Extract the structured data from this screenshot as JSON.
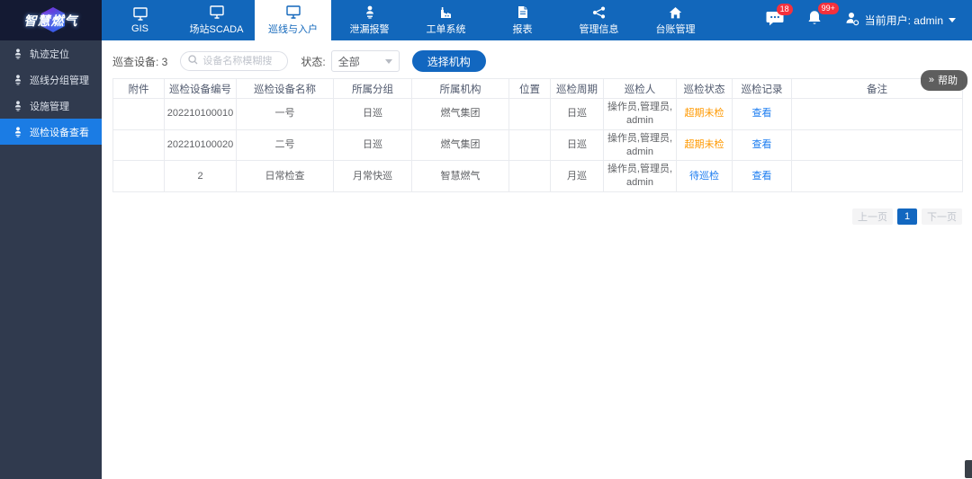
{
  "colors": {
    "nav_blue": "#1267bb",
    "logo_bg": "#141a33",
    "sidebar_bg": "#303a4e",
    "sidebar_active_blue": "#1b7ce4",
    "button_blue": "#1267c0",
    "link_blue": "#1b7cf0",
    "warning_orange": "#ff9900",
    "badge_red": "#f5313d"
  },
  "topnav": {
    "logo_text": "智慧燃气",
    "items": [
      {
        "label": "GIS",
        "icon": "monitor-icon"
      },
      {
        "label": "场站SCADA",
        "icon": "monitor-icon"
      },
      {
        "label": "巡线与入户",
        "icon": "monitor-icon",
        "active": true
      },
      {
        "label": "泄漏报警",
        "icon": "person-pin-icon"
      },
      {
        "label": "工单系统",
        "icon": "factory-icon"
      },
      {
        "label": "报表",
        "icon": "document-icon"
      },
      {
        "label": "管理信息",
        "icon": "share-icon"
      },
      {
        "label": "台账管理",
        "icon": "home-icon"
      }
    ],
    "message_badge": "18",
    "notification_badge": "99+",
    "current_user_label": "当前用户: admin"
  },
  "sidebar": {
    "items": [
      {
        "label": "轨迹定位"
      },
      {
        "label": "巡线分组管理"
      },
      {
        "label": "设施管理"
      },
      {
        "label": "巡检设备查看",
        "active": true
      }
    ]
  },
  "toolbar": {
    "device_count_label": "巡查设备: 3",
    "search_placeholder": "设备名称模糊搜",
    "status_label": "状态:",
    "status_value": "全部",
    "select_org_button": "选择机构"
  },
  "help": {
    "arrow": "»",
    "label": "帮助"
  },
  "table": {
    "columns": [
      "附件",
      "巡检设备编号",
      "巡检设备名称",
      "所属分组",
      "所属机构",
      "位置",
      "巡检周期",
      "巡检人",
      "巡检状态",
      "巡检记录",
      "备注"
    ],
    "rows": [
      {
        "attachment": "",
        "device_no": "202210100010",
        "device_name": "一号",
        "group": "日巡",
        "org": "燃气集团",
        "location": "",
        "cycle": "日巡",
        "inspector": "操作员,管理员,admin",
        "status": "超期未检",
        "record": "查看",
        "remark": ""
      },
      {
        "attachment": "",
        "device_no": "202210100020",
        "device_name": "二号",
        "group": "日巡",
        "org": "燃气集团",
        "location": "",
        "cycle": "日巡",
        "inspector": "操作员,管理员,admin",
        "status": "超期未检",
        "record": "查看",
        "remark": ""
      },
      {
        "attachment": "",
        "device_no": "2",
        "device_name": "日常检查",
        "group": "月常快巡",
        "org": "智慧燃气",
        "location": "",
        "cycle": "月巡",
        "inspector": "操作员,管理员,admin",
        "status": "待巡检",
        "record": "查看",
        "remark": ""
      }
    ]
  },
  "pagination": {
    "prev": "上一页",
    "current": "1",
    "next": "下一页"
  }
}
